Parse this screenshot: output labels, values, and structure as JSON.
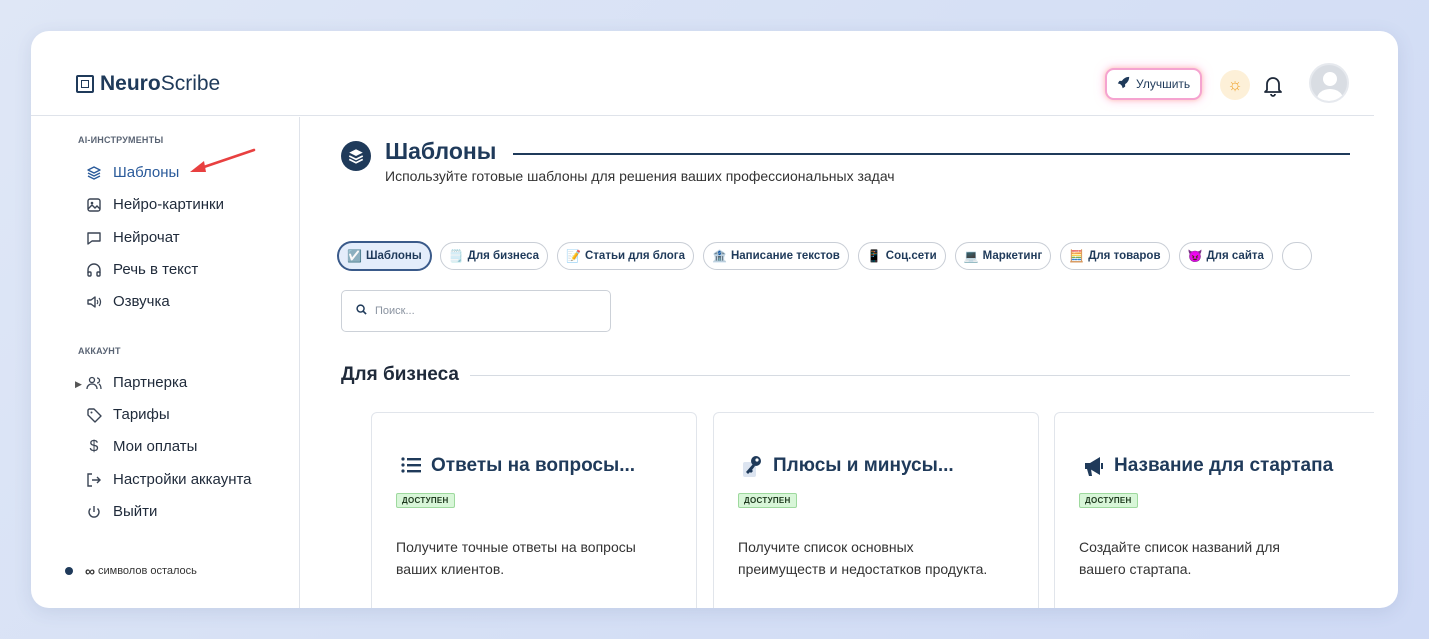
{
  "app": {
    "logo_bold": "Neuro",
    "logo_rest": "Scribe"
  },
  "header": {
    "upgrade_label": "Улучшить"
  },
  "sidebar": {
    "tools_title": "AI-ИНСТРУМЕНТЫ",
    "tools": [
      {
        "label": "Шаблоны",
        "icon": "layers-icon"
      },
      {
        "label": "Нейро-картинки",
        "icon": "image-icon"
      },
      {
        "label": "Нейрочат",
        "icon": "chat-icon"
      },
      {
        "label": "Речь в текст",
        "icon": "headphones-icon"
      },
      {
        "label": "Озвучка",
        "icon": "speaker-icon"
      }
    ],
    "account_title": "АККАУНТ",
    "account": [
      {
        "label": "Партнерка",
        "icon": "users-icon"
      },
      {
        "label": "Тарифы",
        "icon": "tag-icon"
      },
      {
        "label": "Мои оплаты",
        "icon": "dollar-icon"
      },
      {
        "label": "Настройки аккаунта",
        "icon": "logout-arrow-icon"
      },
      {
        "label": "Выйти",
        "icon": "power-icon"
      }
    ],
    "symbols_infinity": "∞",
    "symbols_label": "символов осталось"
  },
  "main": {
    "title": "Шаблоны",
    "subtitle": "Используйте готовые шаблоны для решения ваших профессиональных задач",
    "chips": [
      {
        "emoji": "☑️",
        "label": "Шаблоны",
        "active": true
      },
      {
        "emoji": "🗒️",
        "label": "Для бизнеса"
      },
      {
        "emoji": "📝",
        "label": "Статьи для блога"
      },
      {
        "emoji": "🏦",
        "label": "Написание текстов"
      },
      {
        "emoji": "📱",
        "label": "Соц.сети"
      },
      {
        "emoji": "💻",
        "label": "Маркетинг"
      },
      {
        "emoji": "🧮",
        "label": "Для товаров"
      },
      {
        "emoji": "😈",
        "label": "Для сайта"
      }
    ],
    "search_placeholder": "Поиск...",
    "section_heading": "Для бизнеса",
    "cards": [
      {
        "icon": "list-icon",
        "title": "Ответы на вопросы...",
        "badge": "ДОСТУПЕН",
        "desc": "Получите точные ответы на вопросы ваших клиентов."
      },
      {
        "icon": "key-icon",
        "title": "Плюсы и минусы...",
        "badge": "ДОСТУПЕН",
        "desc": "Получите список основных преимуществ и недостатков продукта."
      },
      {
        "icon": "megaphone-icon",
        "title": "Название для стартапа",
        "badge": "ДОСТУПЕН",
        "desc": "Создайте список названий для вашего стартапа."
      }
    ]
  },
  "colors": {
    "accent": "#1f3a5a",
    "active_nav": "#2a5a9a",
    "badge_bg": "#d8f6d8",
    "arrow": "#e84040"
  }
}
